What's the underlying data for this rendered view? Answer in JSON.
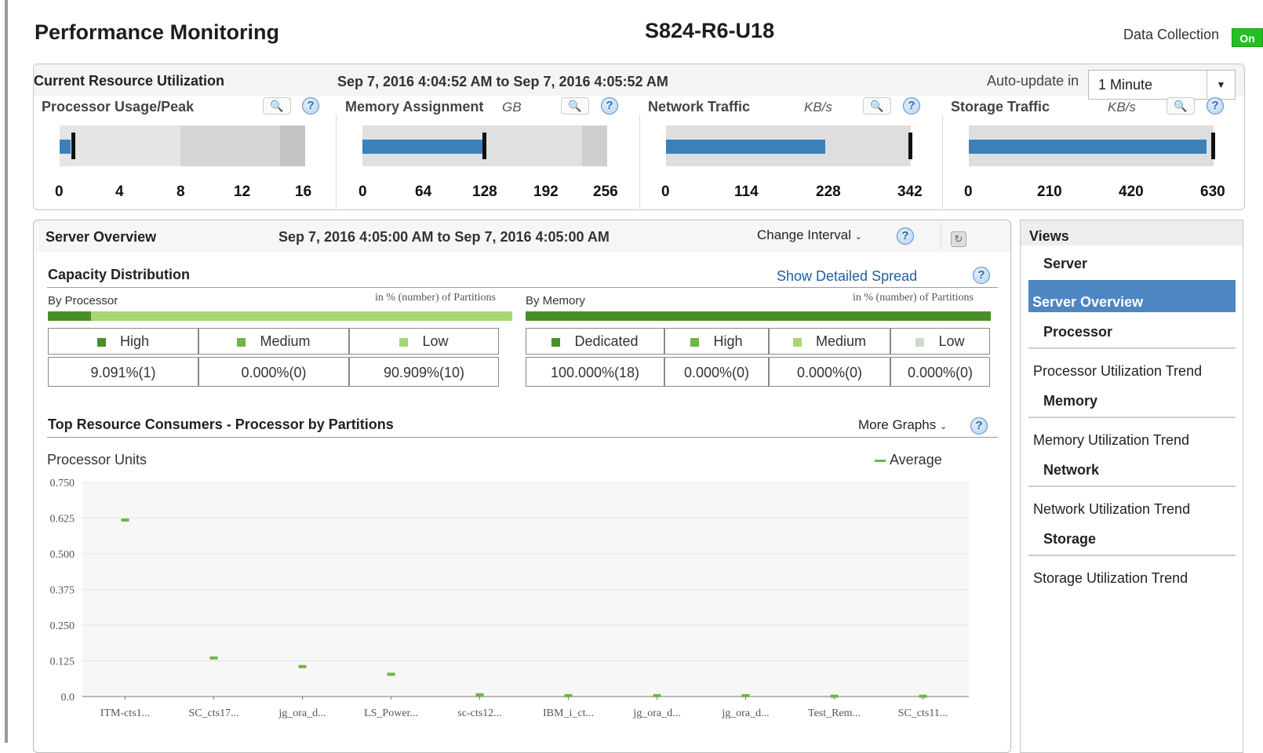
{
  "header": {
    "title": "Performance Monitoring",
    "system_name": "S824-R6-U18",
    "data_collection_label": "Data Collection",
    "data_collection_state": "On"
  },
  "current_utilization": {
    "title": "Current Resource Utilization",
    "time_range": "Sep 7, 2016 4:04:52 AM to Sep 7, 2016 4:05:52 AM",
    "auto_update_label": "Auto-update in",
    "auto_update_value": "1 Minute",
    "gauges": [
      {
        "title": "Processor Usage/Peak",
        "unit": "",
        "ticks": [
          "0",
          "4",
          "8",
          "12",
          "16"
        ],
        "value": 0.7,
        "peak": 0.9,
        "max": 16
      },
      {
        "title": "Memory Assignment",
        "unit": "GB",
        "ticks": [
          "0",
          "64",
          "128",
          "192",
          "256"
        ],
        "value": 126,
        "peak": 128,
        "max": 256
      },
      {
        "title": "Network Traffic",
        "unit": "KB/s",
        "ticks": [
          "0",
          "114",
          "228",
          "342"
        ],
        "value": 222,
        "peak": 342,
        "max": 342
      },
      {
        "title": "Storage Traffic",
        "unit": "KB/s",
        "ticks": [
          "0",
          "210",
          "420",
          "630"
        ],
        "value": 612,
        "peak": 630,
        "max": 630
      }
    ]
  },
  "server_overview": {
    "title": "Server Overview",
    "time_range": "Sep 7, 2016 4:05:00 AM to Sep 7, 2016 4:05:00 AM",
    "change_interval": "Change Interval",
    "capacity": {
      "title": "Capacity Distribution",
      "link": "Show Detailed Spread",
      "note": "in % (number) of Partitions",
      "by_processor": {
        "label": "By Processor",
        "headers": [
          "High",
          "Medium",
          "Low"
        ],
        "values": [
          "9.091%(1)",
          "0.000%(0)",
          "90.909%(10)"
        ],
        "colors": [
          "#4a8e2a",
          "#8cc63f",
          "#a8d672"
        ]
      },
      "by_memory": {
        "label": "By Memory",
        "headers": [
          "Dedicated",
          "High",
          "Medium",
          "Low"
        ],
        "values": [
          "100.000%(18)",
          "0.000%(0)",
          "0.000%(0)",
          "0.000%(0)"
        ],
        "colors": [
          "#4a8e2a",
          "#6fb642",
          "#a8d672",
          "#cfd8cc"
        ]
      }
    },
    "top_consumers": {
      "title": "Top Resource Consumers - Processor by Partitions",
      "more_graphs": "More Graphs",
      "y_label": "Processor Units",
      "legend": "Average"
    }
  },
  "chart_data": {
    "type": "scatter",
    "title": "",
    "xlabel": "",
    "ylabel": "Processor Units",
    "ylim": [
      0,
      0.75
    ],
    "y_ticks": [
      "0.750",
      "0.625",
      "0.500",
      "0.375",
      "0.250",
      "0.125",
      "0.0"
    ],
    "categories": [
      "ITM-cts1...",
      "SC_cts17...",
      "jg_ora_d...",
      "LS_Power...",
      "sc-cts12...",
      "IBM_i_ct...",
      "jg_ora_d...",
      "jg_ora_d...",
      "Test_Rem...",
      "SC_cts11..."
    ],
    "series": [
      {
        "name": "Average",
        "values": [
          0.618,
          0.135,
          0.105,
          0.078,
          0.006,
          0.003,
          0.003,
          0.003,
          0.001,
          0.001
        ]
      }
    ],
    "grid": true,
    "legend_position": "top-right"
  },
  "views": {
    "title": "Views",
    "groups": [
      {
        "label": "Server",
        "items": [
          "Server Overview"
        ]
      },
      {
        "label": "Processor",
        "items": [
          "Processor Utilization Trend"
        ]
      },
      {
        "label": "Memory",
        "items": [
          "Memory Utilization Trend"
        ]
      },
      {
        "label": "Network",
        "items": [
          "Network Utilization Trend"
        ]
      },
      {
        "label": "Storage",
        "items": [
          "Storage Utilization Trend"
        ]
      }
    ]
  }
}
